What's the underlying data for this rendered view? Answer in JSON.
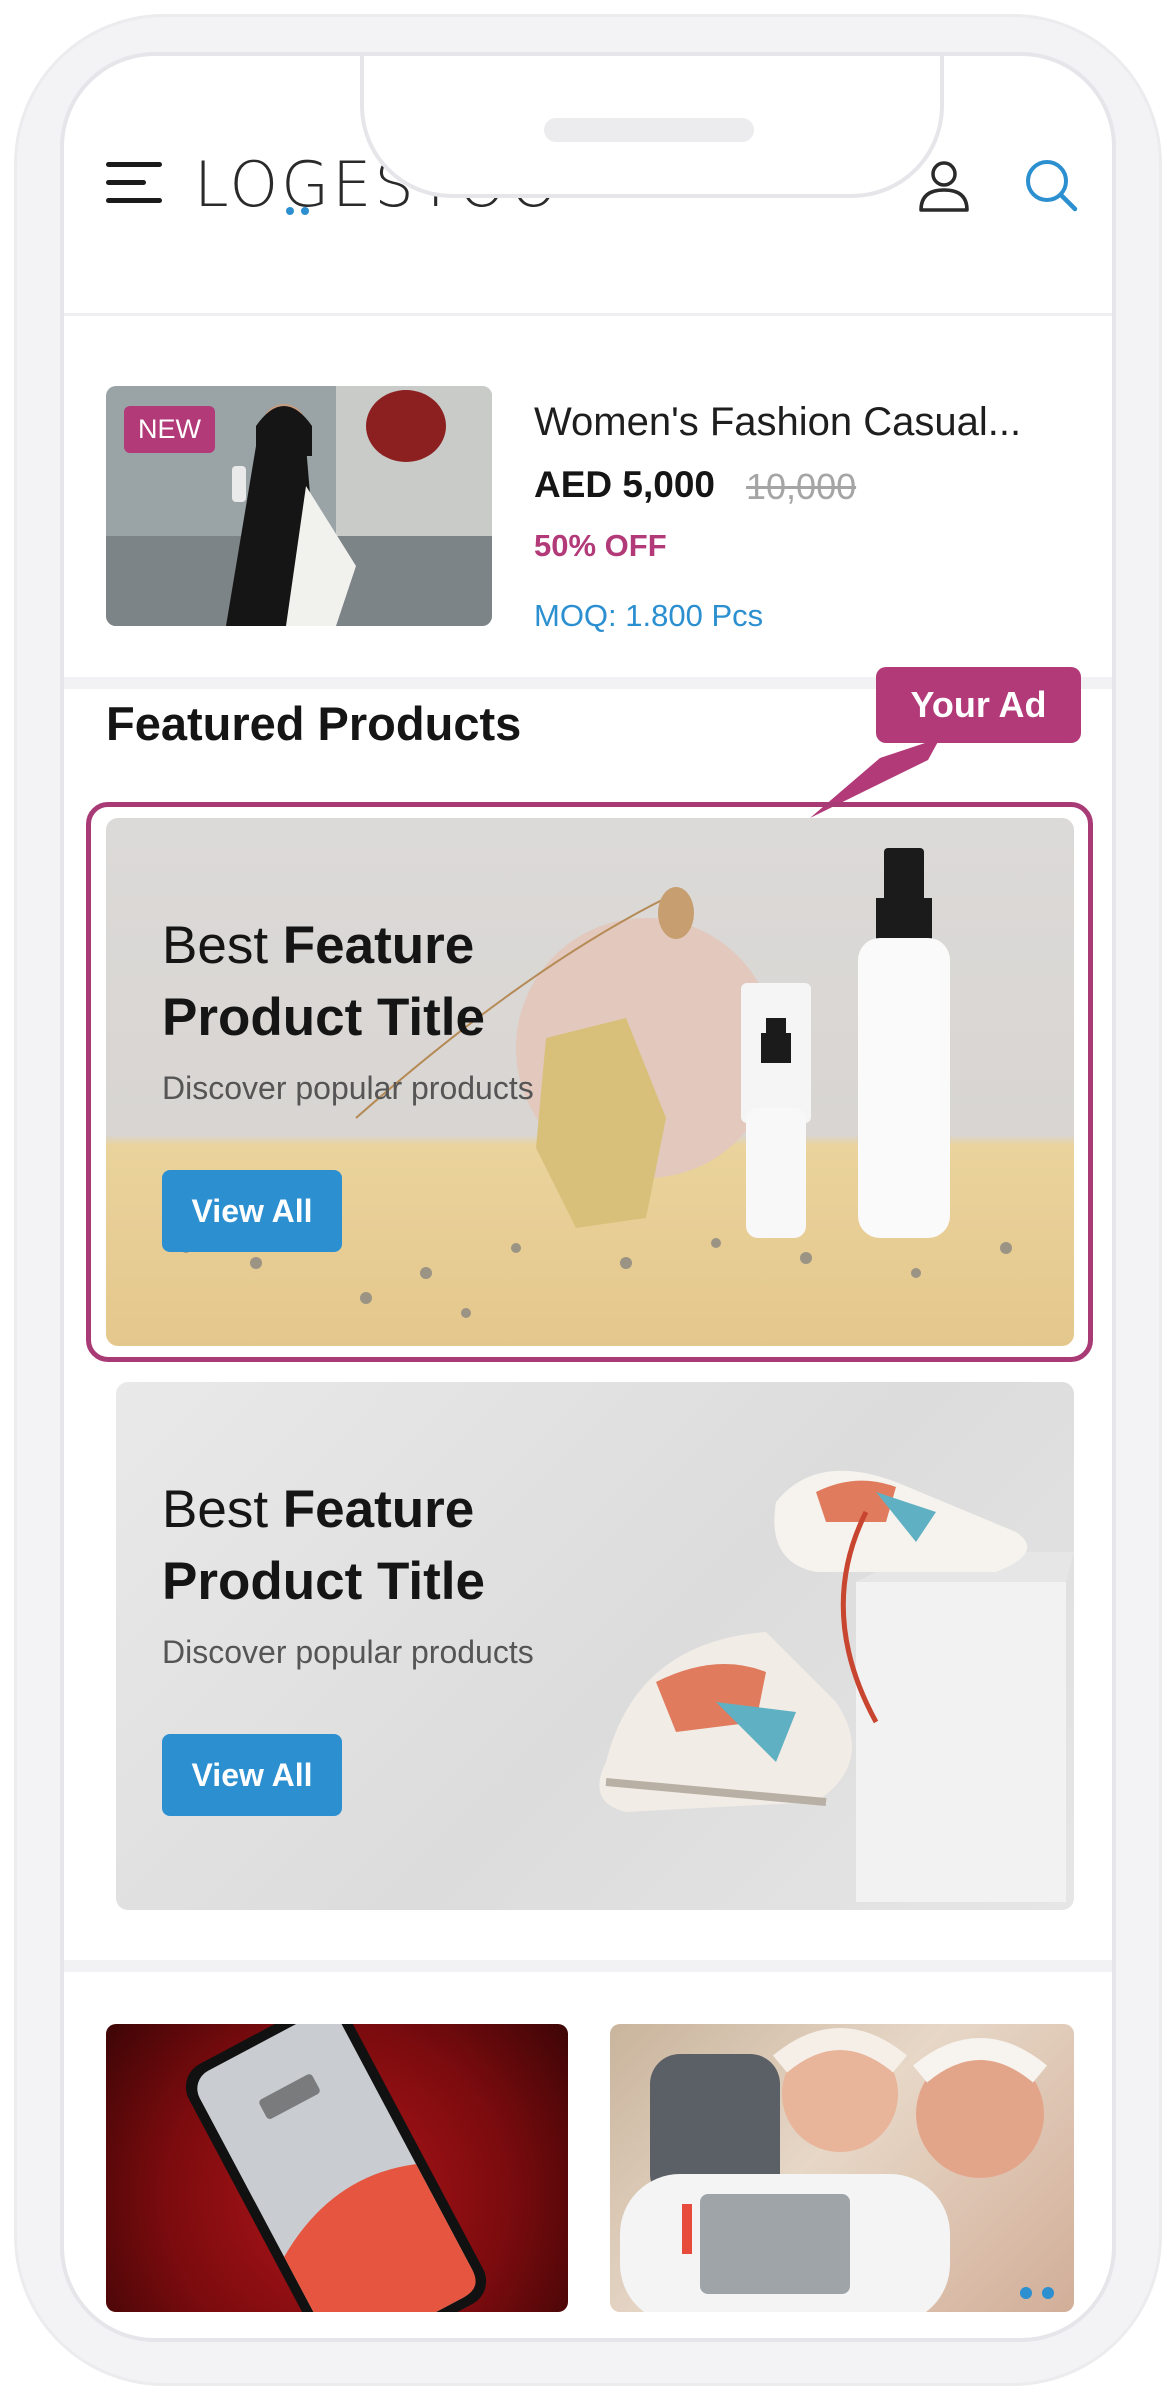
{
  "header": {
    "logo_text": "LOGESTOO",
    "menu_icon": "hamburger-menu-icon",
    "user_icon": "user-icon",
    "search_icon": "search-icon"
  },
  "product": {
    "badge": "NEW",
    "title": "Women's Fashion Casual...",
    "price": "AED 5,000",
    "old_price": "10,000",
    "discount": "50% OFF",
    "moq": "MOQ: 1.800 Pcs"
  },
  "featured": {
    "section_title": "Featured Products",
    "ad_tag": "Your Ad",
    "banners": [
      {
        "title_light": "Best ",
        "title_bold_1": "Feature",
        "title_bold_2": "Product Title",
        "subtitle": "Discover popular products",
        "button": "View All"
      },
      {
        "title_light": "Best ",
        "title_bold_1": "Feature",
        "title_bold_2": "Product Title",
        "subtitle": "Discover popular products",
        "button": "View All"
      }
    ]
  },
  "colors": {
    "accent_blue": "#2b8fd0",
    "brand_magenta": "#b23a78"
  }
}
